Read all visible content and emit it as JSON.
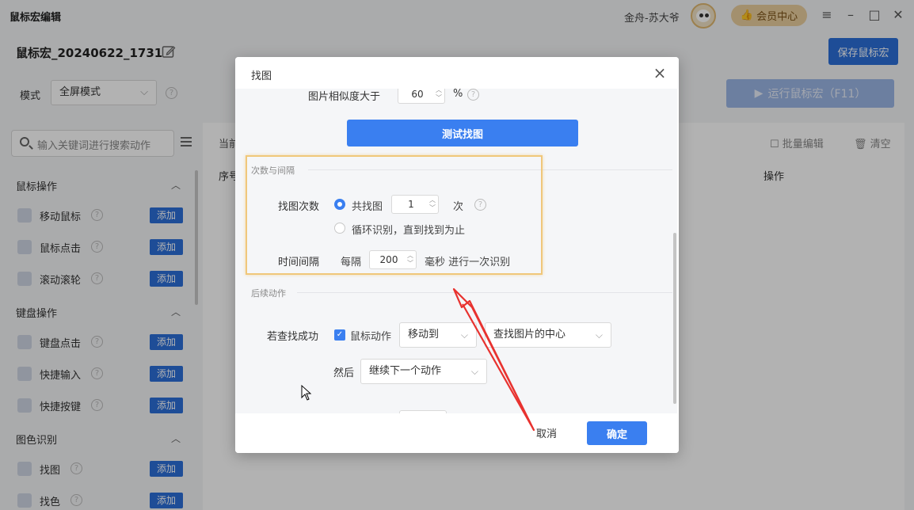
{
  "app": {
    "title": "鼠标宏编辑",
    "user_name": "金舟-苏大爷",
    "vip_label": "会员中心",
    "win_controls": [
      "≡",
      "–",
      "□",
      "✕"
    ]
  },
  "macro": {
    "name": "鼠标宏_20240622_1731",
    "save_label": "保存鼠标宏"
  },
  "mode": {
    "label": "模式",
    "value": "全屏模式",
    "run_label": "运行鼠标宏（F11）"
  },
  "sidebar": {
    "search_placeholder": "输入关键词进行搜索动作",
    "add_label": "添加",
    "categories": [
      {
        "label": "鼠标操作",
        "items": [
          "移动鼠标",
          "鼠标点击",
          "滚动滚轮"
        ]
      },
      {
        "label": "键盘操作",
        "items": [
          "键盘点击",
          "快捷输入",
          "快捷按键"
        ]
      },
      {
        "label": "图色识别",
        "items": [
          "找图",
          "找色"
        ]
      }
    ]
  },
  "content": {
    "current_label": "当前",
    "seq_label": "序号",
    "ops_label": "操作",
    "batch_label": "批量编辑",
    "clear_label": "清空"
  },
  "dialog": {
    "title": "找图",
    "similarity_label": "图片相似度大于",
    "similarity_value": "60",
    "percent": "%",
    "test_button": "测试找图",
    "section_count": "次数与间隔",
    "find_count_label": "找图次数",
    "radio_total": "共找图",
    "find_count_value": "1",
    "times_unit": "次",
    "radio_loop": "循环识别，直到找到为止",
    "interval_label": "时间间隔",
    "every": "每隔",
    "interval_value": "200",
    "interval_suffix": "毫秒 进行一次识别",
    "section_follow": "后续动作",
    "if_success_label": "若查找成功",
    "mouse_action_label": "鼠标动作",
    "action_select": "移动到",
    "target_select": "查找图片的中心",
    "then_label": "然后",
    "then_select": "继续下一个动作",
    "cancel": "取消",
    "ok": "确定"
  },
  "colors": {
    "primary": "#3a7ff0",
    "save_btn": "#2b6fd9",
    "highlight": "#f0c77a",
    "annotation_arrow": "#e8322f"
  }
}
